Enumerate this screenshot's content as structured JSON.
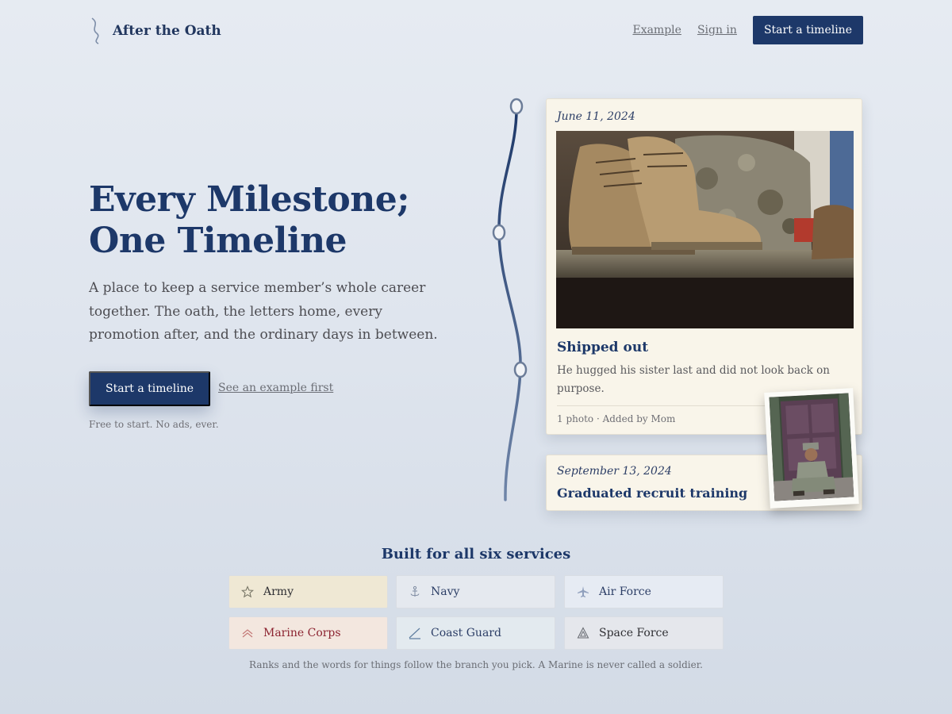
{
  "header": {
    "brand": "After the Oath",
    "nav": {
      "example": "Example",
      "sign_in": "Sign in",
      "cta": "Start a timeline"
    }
  },
  "hero": {
    "title_line1": "Every Milestone;",
    "title_line2": "One Timeline",
    "description": "A place to keep a service member’s whole career together. The oath, the letters home, every promotion after, and the ordinary days in between.",
    "cta": "Start a timeline",
    "secondary_link": "See an example first",
    "note": "Free to start. No ads, ever."
  },
  "timeline": {
    "entries": [
      {
        "date": "June 11, 2024",
        "title": "Shipped out",
        "body": "He hugged his sister last and did not look back on purpose.",
        "meta": "1 photo · Added by Mom",
        "photo": "boots-and-rucksack-photo"
      },
      {
        "date": "September 13, 2024",
        "title": "Graduated recruit training",
        "photo": "soldier-on-doorstep-photo"
      }
    ]
  },
  "services": {
    "title": "Built for all six services",
    "items": [
      {
        "label": "Army",
        "icon": "star-icon",
        "bg": "#efe8d4",
        "color": "#2f2f33"
      },
      {
        "label": "Navy",
        "icon": "anchor-icon",
        "bg": "#e5e9ef",
        "color": "#2c3e66"
      },
      {
        "label": "Air Force",
        "icon": "plane-icon",
        "bg": "#e6ebf3",
        "color": "#2c3e66"
      },
      {
        "label": "Marine Corps",
        "icon": "chevron-up-icon",
        "bg": "#f3e7df",
        "color": "#8c2330"
      },
      {
        "label": "Coast Guard",
        "icon": "pen-icon",
        "bg": "#e3eaef",
        "color": "#2c3e66"
      },
      {
        "label": "Space Force",
        "icon": "delta-icon",
        "bg": "#e5e7ec",
        "color": "#2f2f33"
      }
    ],
    "note": "Ranks and the words for things follow the branch you pick. A Marine is never called a soldier."
  },
  "colors": {
    "navy": "#1d3869",
    "card": "#f9f5ea",
    "background": "#e1e7ef"
  }
}
